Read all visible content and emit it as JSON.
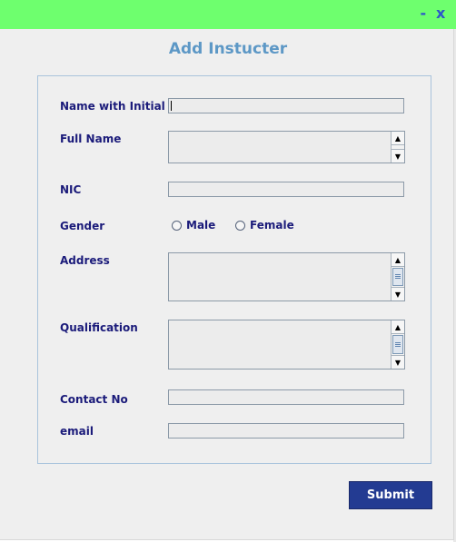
{
  "window": {
    "title": "Add Instucter",
    "minimize_glyph": "-",
    "close_glyph": "x"
  },
  "form": {
    "fields": [
      {
        "label": "Name with Initial",
        "value": ""
      },
      {
        "label": "Full Name",
        "value": ""
      },
      {
        "label": "NIC",
        "value": ""
      },
      {
        "label": "Gender"
      },
      {
        "label": "Address",
        "value": ""
      },
      {
        "label": "Qualification",
        "value": ""
      },
      {
        "label": "Contact No",
        "value": ""
      },
      {
        "label": "email",
        "value": ""
      }
    ],
    "gender_options": [
      "Male",
      "Female"
    ],
    "submit_label": "Submit"
  },
  "icons": {
    "scroll_up": "arrow-up-icon",
    "scroll_down": "arrow-down-icon"
  },
  "colors": {
    "titlebar": "#6eff6e",
    "title_text": "#5d98c6",
    "label_text": "#1b1b7a",
    "submit_bg": "#233b92"
  }
}
